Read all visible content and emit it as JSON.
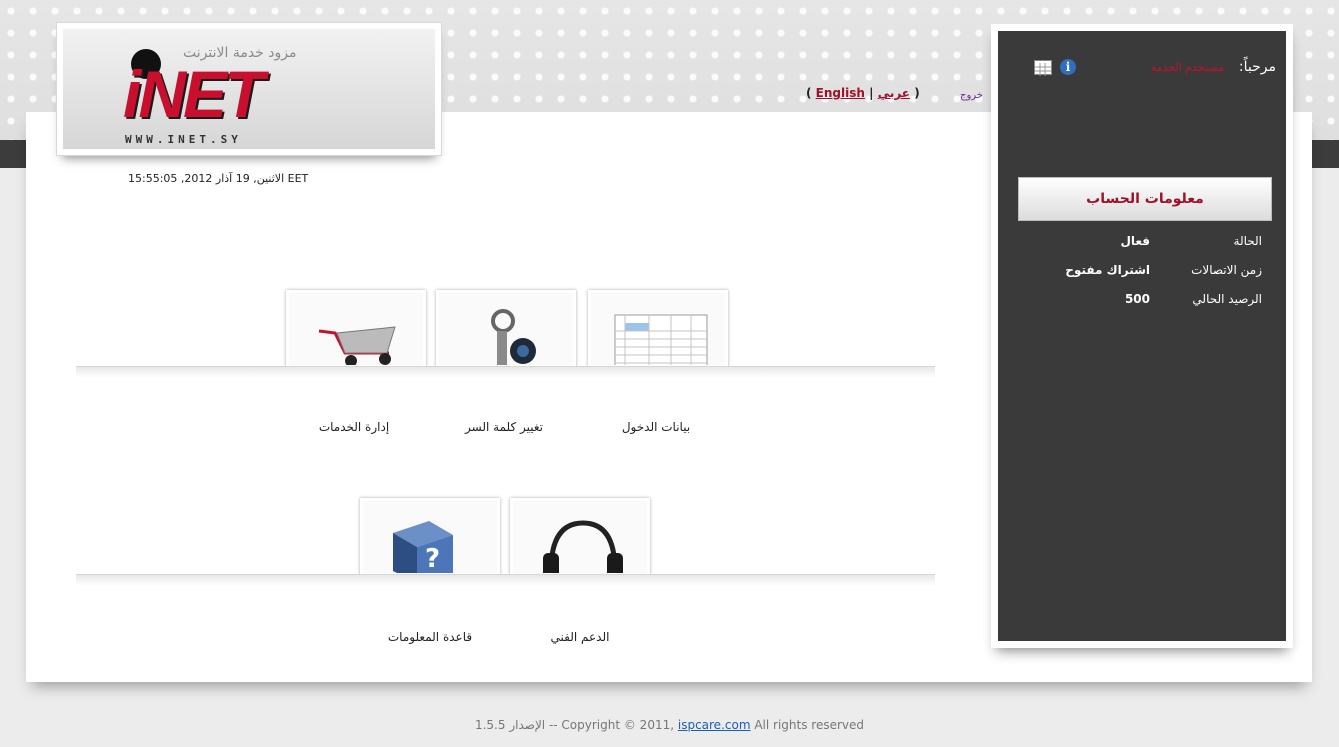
{
  "header": {
    "logo_tagline": "مزود خدمة الانترنت",
    "logo_text": "iNET",
    "logo_url": "WWW.INET.SY",
    "datetime": "الاثنين, 19 آذار 2012, 15:55:05 EET",
    "lang_open": "(",
    "lang_english": "English",
    "lang_sep": "|",
    "lang_arabic": "عربي",
    "lang_close": ")",
    "logout": "خروج"
  },
  "tiles": [
    {
      "label": "بيانات الدخول",
      "icon": "spreadsheet-icon"
    },
    {
      "label": "تغيير كلمة السر",
      "icon": "keys-icon"
    },
    {
      "label": "إدارة الخدمات",
      "icon": "shopping-cart-icon"
    },
    {
      "label": "الدعم الفني",
      "icon": "headphones-icon"
    },
    {
      "label": "قاعدة المعلومات",
      "icon": "help-cube-icon"
    }
  ],
  "sidebar": {
    "welcome": "مرحباً:",
    "username": "مستخدم الخدمة",
    "account_button": "معلومات الحساب",
    "rows": [
      {
        "label": "الحالة",
        "value": "فعال"
      },
      {
        "label": "زمن الاتصالات",
        "value": "اشتراك مفتوح"
      },
      {
        "label": "الرصيد الحالي",
        "value": "500"
      }
    ]
  },
  "footer": {
    "prefix": "1.5.5 الإصدار -- Copyright © 2011,",
    "link": "ispcare.com",
    "suffix": "All rights reserved"
  },
  "colors": {
    "accent": "#c8102e",
    "sidebar_bg": "#3a3a3a"
  }
}
